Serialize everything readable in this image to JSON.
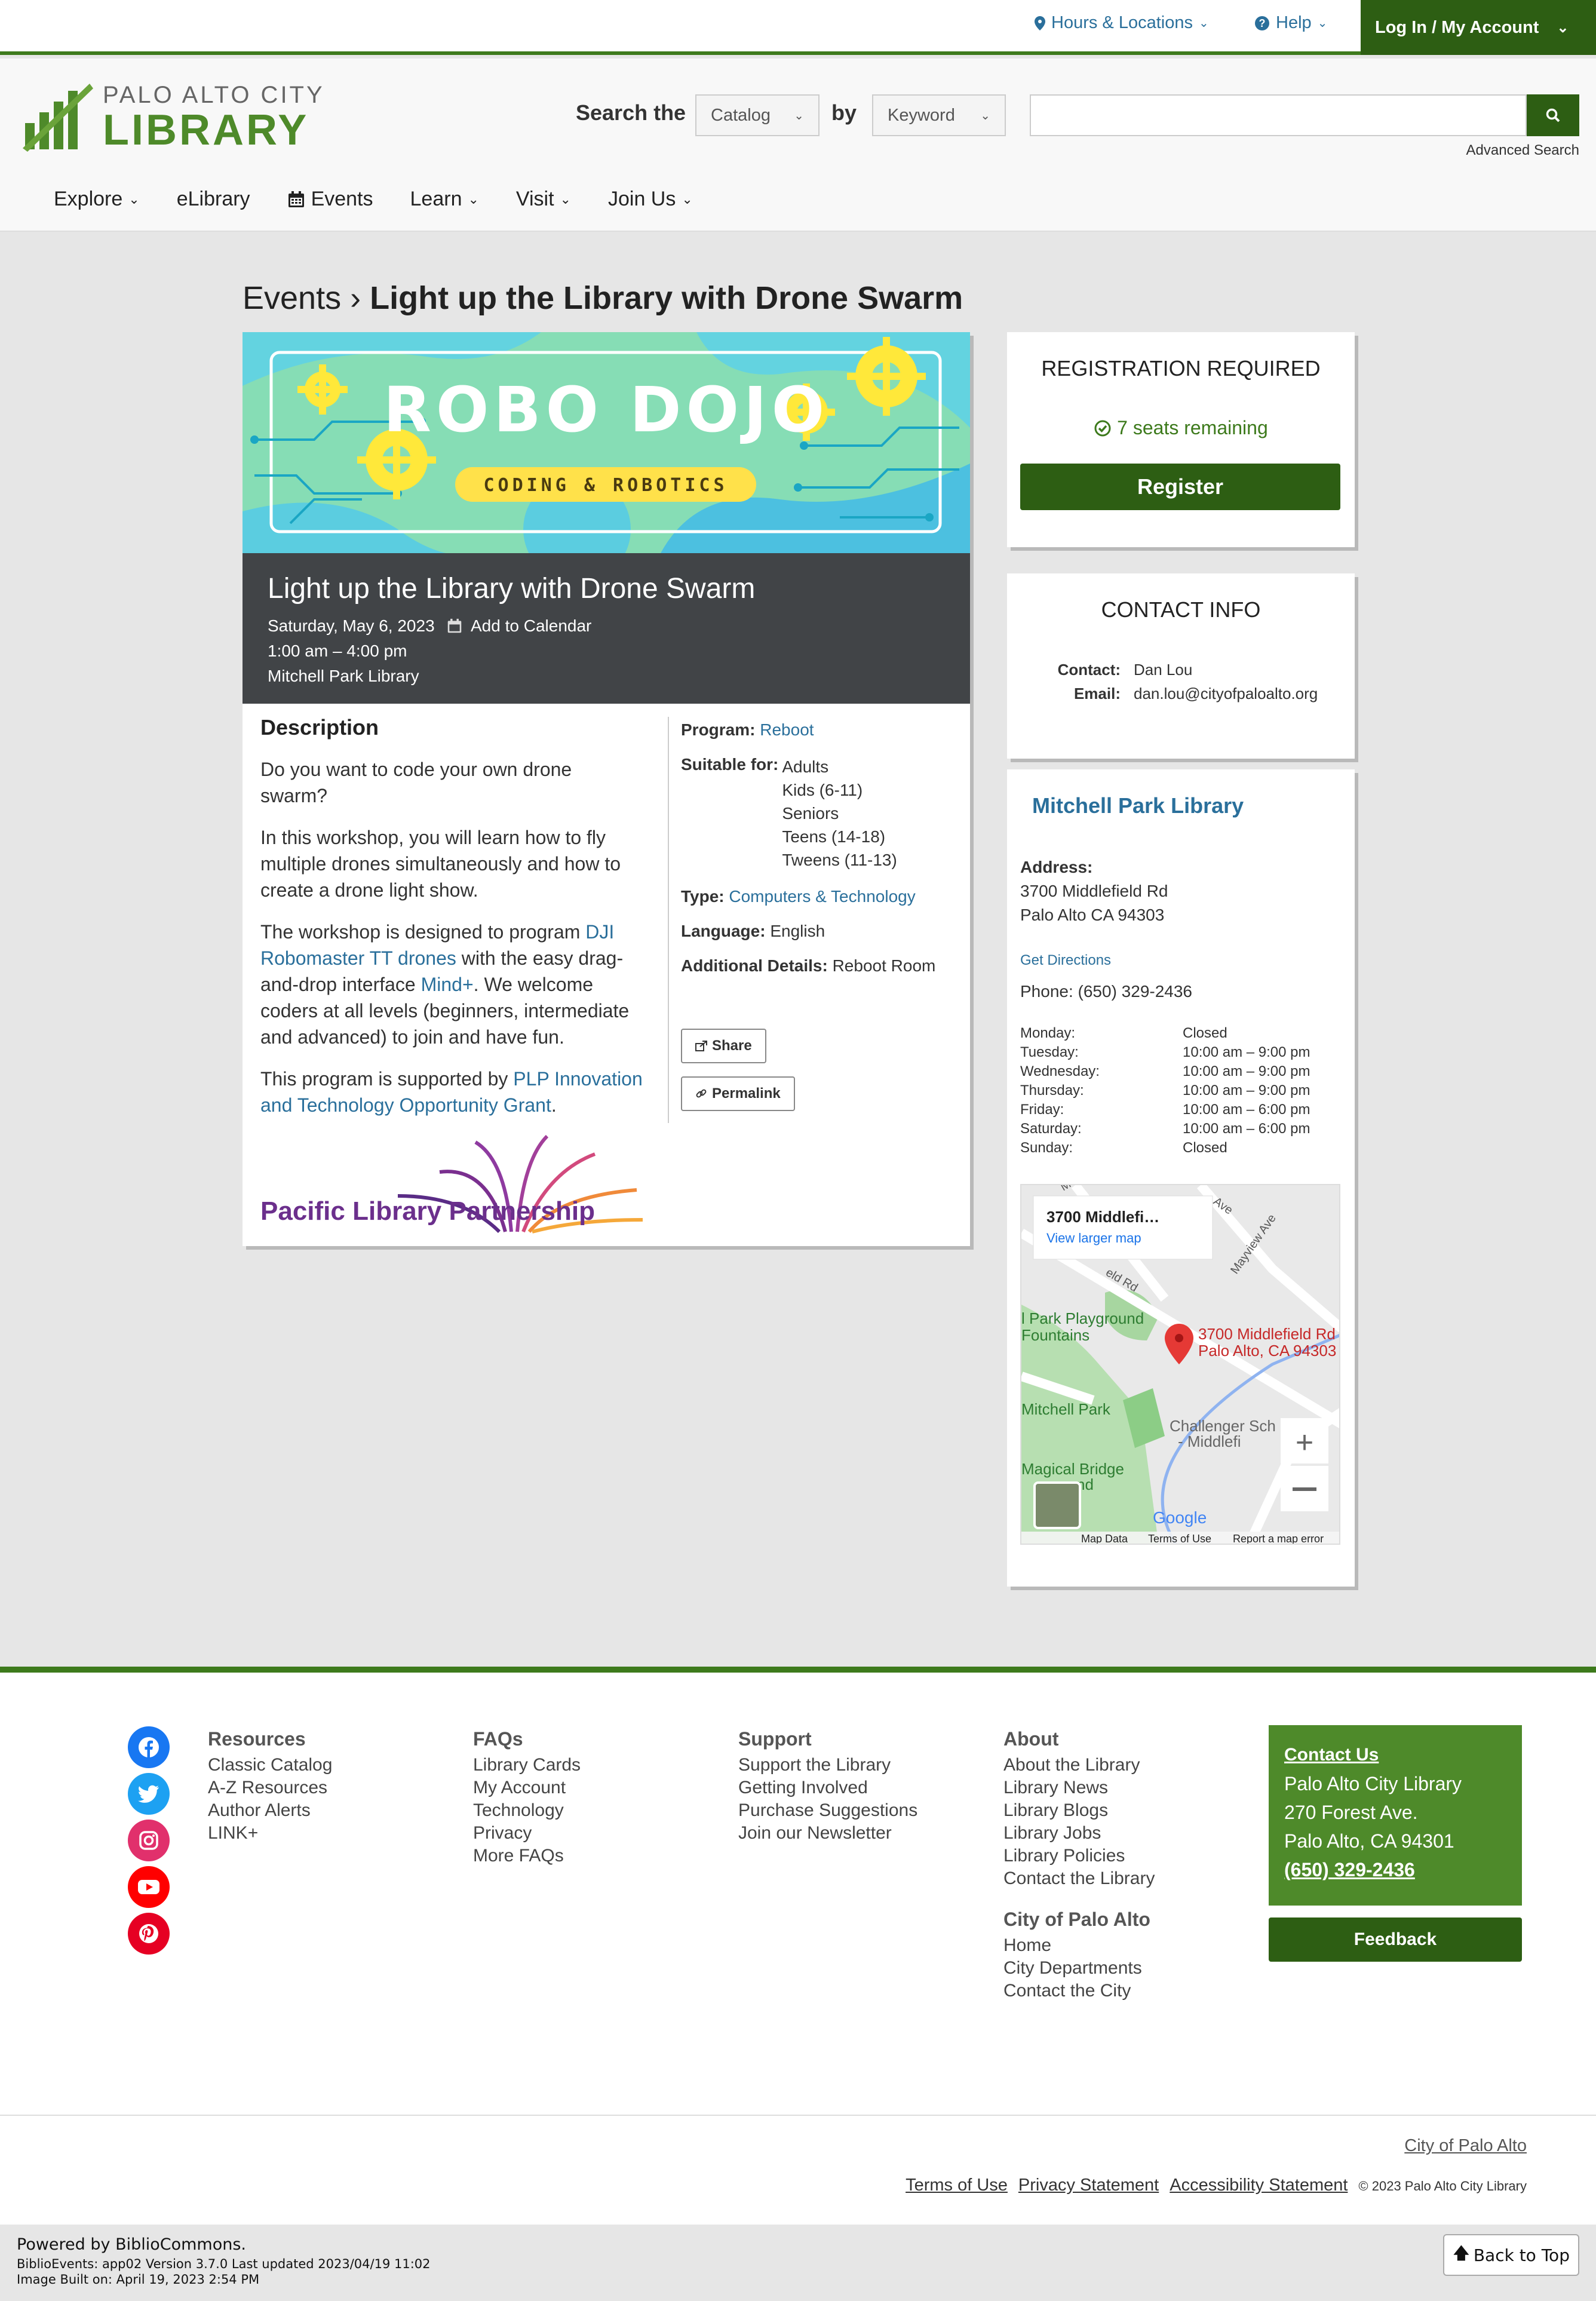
{
  "utility": {
    "hours": "Hours & Locations",
    "help": "Help",
    "login": "Log In / My Account"
  },
  "logo": {
    "line1": "PALO ALTO CITY",
    "line2": "LIBRARY"
  },
  "search": {
    "label_prefix": "Search the",
    "label_by": "by",
    "scope": "Catalog",
    "field": "Keyword",
    "query": "",
    "advanced": "Advanced Search"
  },
  "nav": {
    "explore": "Explore",
    "elibrary": "eLibrary",
    "events": "Events",
    "learn": "Learn",
    "visit": "Visit",
    "join": "Join Us"
  },
  "breadcrumb": {
    "parent": "Events",
    "sep": "›",
    "current": "Light up the Library with Drone Swarm"
  },
  "banner": {
    "title": "ROBO DOJO",
    "subtitle": "CODING & ROBOTICS"
  },
  "event": {
    "title": "Light up the Library with Drone Swarm",
    "date": "Saturday, May 6, 2023",
    "add_calendar": "Add to Calendar",
    "time": "1:00 am – 4:00 pm",
    "location": "Mitchell Park Library",
    "description_heading": "Description",
    "p1": "Do you want to code your own drone swarm?",
    "p2": "In this workshop, you will learn how to fly multiple drones simultaneously and how to create a drone light show.",
    "p3_a": "The workshop is designed to program ",
    "p3_link1": "DJI Robomaster TT drones",
    "p3_b": " with the easy drag-and-drop interface ",
    "p3_link2": "Mind+",
    "p3_c": ". We welcome coders at all levels (beginners, intermediate and advanced) to join and have fun.",
    "p4_a": "This program is supported by ",
    "p4_link": "PLP Innovation and Technology Opportunity Grant",
    "p4_b": ".",
    "program_label": "Program:",
    "program": "Reboot",
    "suitable_label": "Suitable for:",
    "suitable": [
      "Adults",
      "Kids (6-11)",
      "Seniors",
      "Teens (14-18)",
      "Tweens (11-13)"
    ],
    "type_label": "Type:",
    "type": "Computers & Technology",
    "language_label": "Language:",
    "language": "English",
    "details_label": "Additional Details:",
    "details": "Reboot Room",
    "share": "Share",
    "permalink": "Permalink",
    "partner": "Pacific Library Partnership"
  },
  "registration": {
    "heading": "REGISTRATION REQUIRED",
    "seats": "7 seats remaining",
    "button": "Register"
  },
  "contact": {
    "heading": "CONTACT INFO",
    "contact_label": "Contact:",
    "contact": "Dan Lou",
    "email_label": "Email:",
    "email": "dan.lou@cityofpaloalto.org"
  },
  "branch": {
    "name": "Mitchell Park Library",
    "address_label": "Address:",
    "street": "3700 Middlefield Rd",
    "city": "Palo Alto CA 94303",
    "directions": "Get Directions",
    "phone": "Phone: (650) 329-2436",
    "hours": [
      {
        "day": "Monday:",
        "time": "Closed"
      },
      {
        "day": "Tuesday:",
        "time": "10:00 am – 9:00 pm"
      },
      {
        "day": "Wednesday:",
        "time": "10:00 am – 9:00 pm"
      },
      {
        "day": "Thursday:",
        "time": "10:00 am – 9:00 pm"
      },
      {
        "day": "Friday:",
        "time": "10:00 am – 6:00 pm"
      },
      {
        "day": "Saturday:",
        "time": "10:00 am – 6:00 pm"
      },
      {
        "day": "Sunday:",
        "time": "Closed"
      }
    ],
    "map": {
      "popup_title": "3700 Middlefi…",
      "popup_link": "View larger map",
      "pin_label1": "3700 Middlefield Rd",
      "pin_label2": "Palo Alto, CA 94303",
      "label_playground": "l Park Playground",
      "label_fountains": "Fountains",
      "label_mitchell": "Mitchell Park",
      "label_magical": "Magical Bridge",
      "label_ground": "ground",
      "label_challenger": "Challenger Sch",
      "label_middlefi": "- Middlefi",
      "label_mayview": "Mayview Ave",
      "label_rd": "eld Rd",
      "label_ave": "Ave",
      "label_meado": "Meado",
      "google": "Google",
      "map_data": "Map Data",
      "terms": "Terms of Use",
      "report": "Report a map error"
    }
  },
  "footer": {
    "resources": {
      "h": "Resources",
      "items": [
        "Classic Catalog",
        "A-Z Resources",
        "Author Alerts",
        "LINK+"
      ]
    },
    "faqs": {
      "h": "FAQs",
      "items": [
        "Library Cards",
        "My Account",
        "Technology",
        "Privacy",
        "More FAQs"
      ]
    },
    "support": {
      "h": "Support",
      "items": [
        "Support the Library",
        "Getting Involved",
        "Purchase Suggestions",
        "Join our Newsletter"
      ]
    },
    "about": {
      "h": "About",
      "items": [
        "About the Library",
        "Library News",
        "Library Blogs",
        "Library Jobs",
        "Library Policies",
        "Contact the Library"
      ]
    },
    "city": {
      "h": "City of Palo Alto",
      "items": [
        "Home",
        "City Departments",
        "Contact the City"
      ]
    },
    "contact_box": {
      "heading": "Contact Us",
      "name": "Palo Alto City Library",
      "street": "270 Forest Ave.",
      "city": "Palo Alto, CA 94301",
      "phone": "(650) 329-2436"
    },
    "feedback": "Feedback"
  },
  "subfooter": {
    "city": "City of Palo Alto",
    "terms": "Terms of Use",
    "privacy": "Privacy Statement",
    "access": "Accessibility Statement",
    "copyright": "© 2023 Palo Alto City Library"
  },
  "powered": {
    "line1": "Powered by BiblioCommons.",
    "line2": "BiblioEvents: app02 Version 3.7.0 Last updated 2023/04/19 11:02",
    "line3": "Image Built on: April 19, 2023 2:54 PM",
    "back_top": "Back to Top"
  },
  "colors": {
    "brand_green": "#4e8a2a",
    "dark_green": "#2d5e13",
    "link_blue": "#2a6f9b"
  }
}
